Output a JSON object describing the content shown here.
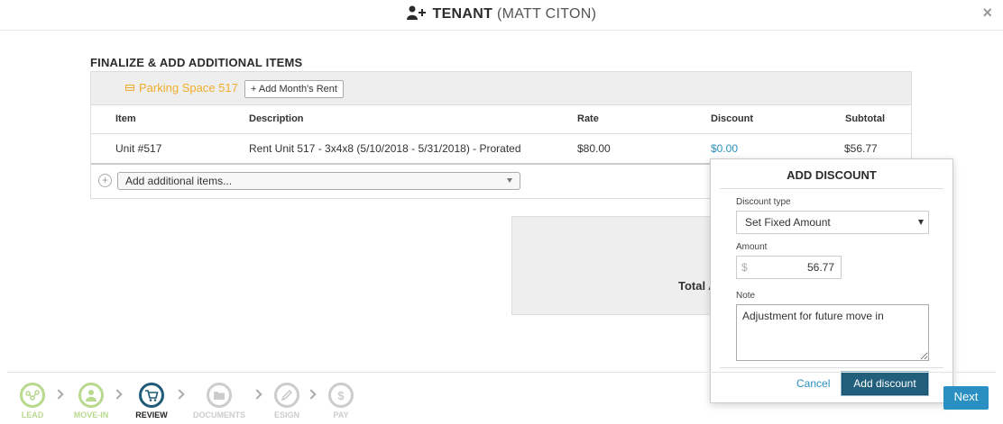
{
  "header": {
    "title": "TENANT",
    "tenant_name": "(MATT CITON)",
    "close_label": "×"
  },
  "section_title": "FINALIZE & ADD ADDITIONAL ITEMS",
  "parking": {
    "label": "Parking Space 517",
    "add_rent_button": "+ Add Month's Rent"
  },
  "table": {
    "columns": [
      "Item",
      "Description",
      "Rate",
      "Discount",
      "Subtotal"
    ],
    "rows": [
      {
        "item": "Unit #517",
        "description": "Rent Unit 517 - 3x4x8 (5/10/2018 - 5/31/2018) - Prorated",
        "rate": "$80.00",
        "discount": "$0.00",
        "subtotal": "$56.77"
      }
    ]
  },
  "add_items": {
    "plus": "+",
    "placeholder": "Add additional items..."
  },
  "total": {
    "label": "Total A"
  },
  "popover": {
    "title": "ADD DISCOUNT",
    "discount_type_label": "Discount type",
    "discount_type_value": "Set Fixed Amount",
    "amount_label": "Amount",
    "currency_symbol": "$",
    "amount_value": "56.77",
    "note_label": "Note",
    "note_value": "Adjustment for future move in",
    "cancel_label": "Cancel",
    "add_button": "Add discount"
  },
  "steps": [
    {
      "label": "LEAD",
      "icon": "lead-icon",
      "color": "#b9d98f"
    },
    {
      "label": "MOVE-IN",
      "icon": "person-icon",
      "color": "#b9d98f"
    },
    {
      "label": "REVIEW",
      "icon": "cart-icon",
      "color": "#1f5a78"
    },
    {
      "label": "DOCUMENTS",
      "icon": "folder-icon",
      "color": "#cccccc"
    },
    {
      "label": "ESIGN",
      "icon": "pen-icon",
      "color": "#cccccc"
    },
    {
      "label": "PAY",
      "icon": "dollar-icon",
      "color": "#cccccc"
    }
  ],
  "next_button": "Next",
  "colors": {
    "accent_blue": "#2a8fbd",
    "parking_orange": "#f0ad2b",
    "primary_dark_blue": "#215f7d",
    "completed_green": "#b9d98f"
  }
}
